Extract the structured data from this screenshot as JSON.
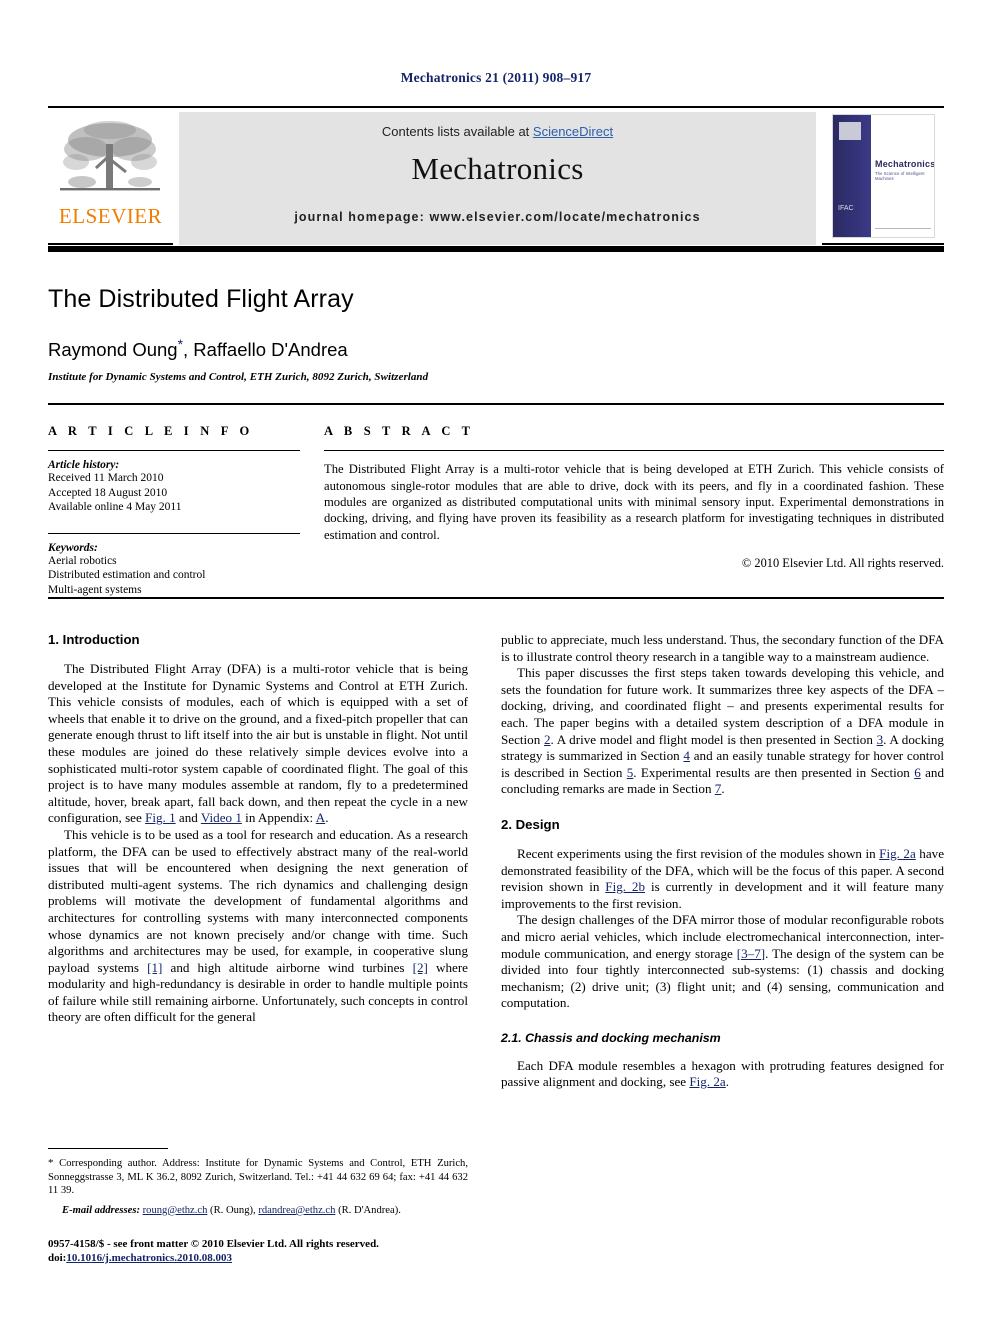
{
  "running_head": "Mechatronics 21 (2011) 908–917",
  "masthead": {
    "contents_prefix": "Contents lists available at ",
    "sciencedirect": "ScienceDirect",
    "journal_title": "Mechatronics",
    "homepage": "journal homepage: www.elsevier.com/locate/mechatronics",
    "publisher_logo_text": "ELSEVIER",
    "cover": {
      "title": "Mechatronics",
      "subtitle": "The Science of Intelligent Machines",
      "org": "IFAC"
    }
  },
  "title_block": {
    "title": "The Distributed Flight Array",
    "authors": "Raymond Oung",
    "author_star": "*",
    "authors_rest": ", Raffaello D'Andrea",
    "affiliation": "Institute for Dynamic Systems and Control, ETH Zurich, 8092 Zurich, Switzerland"
  },
  "article_info": {
    "heading": "A R T I C L E   I N F O",
    "history_label": "Article history:",
    "history": [
      "Received 11 March 2010",
      "Accepted 18 August 2010",
      "Available online 4 May 2011"
    ],
    "keywords_label": "Keywords:",
    "keywords": [
      "Aerial robotics",
      "Distributed estimation and control",
      "Multi-agent systems"
    ]
  },
  "abstract": {
    "heading": "A B S T R A C T",
    "text": "The Distributed Flight Array is a multi-rotor vehicle that is being developed at ETH Zurich. This vehicle consists of autonomous single-rotor modules that are able to drive, dock with its peers, and fly in a coordinated fashion. These modules are organized as distributed computational units with minimal sensory input. Experimental demonstrations in docking, driving, and flying have proven its feasibility as a research platform for investigating techniques in distributed estimation and control.",
    "copyright": "© 2010 Elsevier Ltd. All rights reserved."
  },
  "body": {
    "left": {
      "section1_heading": "1. Introduction",
      "p1_a": "The Distributed Flight Array (DFA) is a multi-rotor vehicle that is being developed at the Institute for Dynamic Systems and Control at ETH Zurich. This vehicle consists of modules, each of which is equipped with a set of wheels that enable it to drive on the ground, and a fixed-pitch propeller that can generate enough thrust to lift itself into the air but is unstable in flight. Not until these modules are joined do these relatively simple devices evolve into a sophisticated multi-rotor system capable of coordinated flight. The goal of this project is to have many modules assemble at random, fly to a predetermined altitude, hover, break apart, fall back down, and then repeat the cycle in a new configuration, see ",
      "p1_ref1": "Fig. 1",
      "p1_mid": " and ",
      "p1_ref2": "Video 1",
      "p1_mid2": " in Appendix: ",
      "p1_ref3": "A",
      "p1_end": ".",
      "p2_a": "This vehicle is to be used as a tool for research and education. As a research platform, the DFA can be used to effectively abstract many of the real-world issues that will be encountered when designing the next generation of distributed multi-agent systems. The rich dynamics and challenging design problems will motivate the development of fundamental algorithms and architectures for controlling systems with many interconnected components whose dynamics are not known precisely and/or change with time. Such algorithms and architectures may be used, for example, in cooperative slung payload systems ",
      "p2_ref1": "[1]",
      "p2_mid": " and high altitude airborne wind turbines ",
      "p2_ref2": "[2]",
      "p2_end": " where modularity and high-redundancy is desirable in order to handle multiple points of failure while still remaining airborne. Unfortunately, such concepts in control theory are often difficult for the general"
    },
    "right": {
      "p3_a": "public to appreciate, much less understand. Thus, the secondary function of the DFA is to illustrate control theory research in a tangible way to a mainstream audience.",
      "p4_a": "This paper discusses the first steps taken towards developing this vehicle, and sets the foundation for future work. It summarizes three key aspects of the DFA – docking, driving, and coordinated flight – and presents experimental results for each. The paper begins with a detailed system description of a DFA module in Section ",
      "p4_r1": "2",
      "p4_b": ". A drive model and flight model is then presented in Section ",
      "p4_r2": "3",
      "p4_c": ". A docking strategy is summarized in Section ",
      "p4_r3": "4",
      "p4_d": " and an easily tunable strategy for hover control is described in Section ",
      "p4_r4": "5",
      "p4_e": ". Experimental results are then presented in Section ",
      "p4_r5": "6",
      "p4_f": " and concluding remarks are made in Section ",
      "p4_r6": "7",
      "p4_g": ".",
      "section2_heading": "2. Design",
      "p5_a": "Recent experiments using the first revision of the modules shown in ",
      "p5_r1": "Fig. 2a",
      "p5_b": " have demonstrated feasibility of the DFA, which will be the focus of this paper. A second revision shown in ",
      "p5_r2": "Fig. 2b",
      "p5_c": " is currently in development and it will feature many improvements to the first revision.",
      "p6_a": "The design challenges of the DFA mirror those of modular reconfigurable robots and micro aerial vehicles, which include electromechanical interconnection, inter-module communication, and energy storage ",
      "p6_r1": "[3–7]",
      "p6_b": ". The design of the system can be divided into four tightly interconnected sub-systems: (1) chassis and docking mechanism; (2) drive unit; (3) flight unit; and (4) sensing, communication and computation.",
      "section21_heading": "2.1. Chassis and docking mechanism",
      "p7_a": "Each DFA module resembles a hexagon with protruding features designed for passive alignment and docking, see ",
      "p7_r1": "Fig. 2a",
      "p7_b": "."
    }
  },
  "footnote": {
    "star": "*",
    "text": " Corresponding author. Address: Institute for Dynamic Systems and Control, ETH Zurich, Sonneggstrasse 3, ML K 36.2, 8092 Zurich, Switzerland. Tel.: +41 44 632 69 64; fax: +41 44 632 11 39.",
    "email_label": "E-mail addresses:",
    "email1": "roung@ethz.ch",
    "email1_owner": " (R. Oung), ",
    "email2": "rdandrea@ethz.ch",
    "email2_owner": " (R. D'Andrea)."
  },
  "issn": {
    "line1": "0957-4158/$ - see front matter © 2010 Elsevier Ltd. All rights reserved.",
    "doi_label": "doi:",
    "doi": "10.1016/j.mechatronics.2010.08.003"
  },
  "colors": {
    "link": "#14246b",
    "sciencedirect": "#2b5faa",
    "elsevier_orange": "#f07d00",
    "band": "#e3e3e3"
  }
}
